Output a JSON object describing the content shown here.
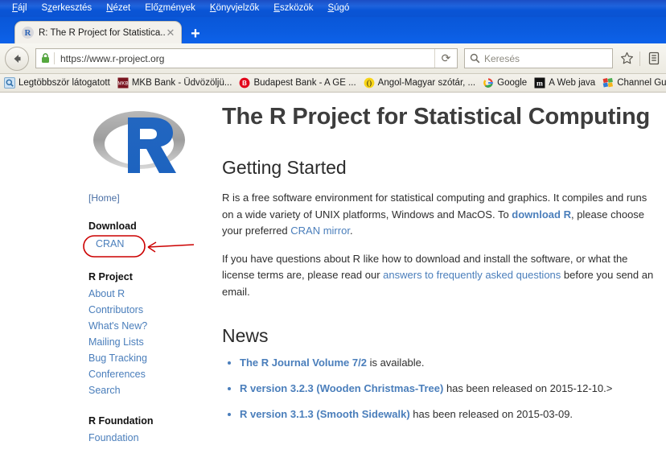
{
  "browser": {
    "menu": [
      {
        "label": "Fájl",
        "accel": "F"
      },
      {
        "label": "Szerkesztés",
        "accel": "z"
      },
      {
        "label": "Nézet",
        "accel": "N"
      },
      {
        "label": "Előzmények",
        "accel": "m"
      },
      {
        "label": "Könyvjelzők",
        "accel": "K"
      },
      {
        "label": "Eszközök",
        "accel": "E"
      },
      {
        "label": "Súgó",
        "accel": "S"
      }
    ],
    "tab": {
      "title": "R: The R Project for Statistica...",
      "favicon": "r-favicon",
      "close_label": "✕"
    },
    "newtab_label": "+",
    "back_icon": "back-arrow-icon",
    "lock_icon": "padlock-icon",
    "url": "https://www.r-project.org",
    "reload_label": "⟳",
    "search_placeholder": "Keresés",
    "search_icon": "magnifier-icon",
    "bookmark_star_icon": "star-icon",
    "library_icon": "library-icon",
    "bookmarks": [
      {
        "label": "Legtöbbször látogatott",
        "icon": "most-visited-icon"
      },
      {
        "label": "MKB Bank - Üdvözöljü...",
        "icon": "mkb-bank-icon"
      },
      {
        "label": "Budapest Bank - A GE ...",
        "icon": "budapest-bank-icon"
      },
      {
        "label": "Angol-Magyar szótár, ...",
        "icon": "dictionary-icon"
      },
      {
        "label": "Google",
        "icon": "google-icon"
      },
      {
        "label": "A Web java",
        "icon": "m-icon"
      },
      {
        "label": "Channel Guide",
        "icon": "channel-guide-icon"
      }
    ]
  },
  "site": {
    "logo_letter": "R",
    "home_link": "[Home]",
    "sidebar": [
      {
        "type": "heading",
        "label": "Download"
      },
      {
        "type": "annotated-link",
        "label": "CRAN"
      },
      {
        "type": "heading",
        "label": "R Project"
      },
      {
        "type": "link",
        "label": "About R"
      },
      {
        "type": "link",
        "label": "Contributors"
      },
      {
        "type": "link",
        "label": "What's New?"
      },
      {
        "type": "link",
        "label": "Mailing Lists"
      },
      {
        "type": "link",
        "label": "Bug Tracking"
      },
      {
        "type": "link",
        "label": "Conferences"
      },
      {
        "type": "link",
        "label": "Search"
      },
      {
        "type": "heading",
        "label": "R Foundation"
      },
      {
        "type": "link",
        "label": "Foundation"
      }
    ],
    "title": "The R Project for Statistical Computing",
    "getting_started_heading": "Getting Started",
    "para1_a": "R is a free software environment for statistical computing and graphics. It compiles and runs on a wide variety of UNIX platforms, Windows and MacOS. To ",
    "para1_link1": "download R",
    "para1_b": ", please choose your preferred ",
    "para1_link2": "CRAN mirror",
    "para1_c": ".",
    "para2_a": "If you have questions about R like how to download and install the software, or what the license terms are, please read our ",
    "para2_link": "answers to frequently asked questions",
    "para2_b": " before you send an email.",
    "news_heading": "News",
    "news": [
      {
        "link": "The R Journal Volume 7/2",
        "rest": " is available."
      },
      {
        "link": "R version 3.2.3 (Wooden Christmas-Tree)",
        "rest": " has been released on 2015-12-10.>"
      },
      {
        "link": "R version 3.1.3 (Smooth Sidewalk)",
        "rest": " has been released on 2015-03-09."
      }
    ]
  },
  "annotation": {
    "shape": "red-ellipse-around-cran",
    "arrow": "red-arrow-pointing-left",
    "color": "#cc0000"
  },
  "colors": {
    "titlebar_blue": "#0a55d6",
    "link_blue": "#4a7ebb",
    "annotation_red": "#cc0000",
    "heading_gray": "#3d3d3d"
  }
}
